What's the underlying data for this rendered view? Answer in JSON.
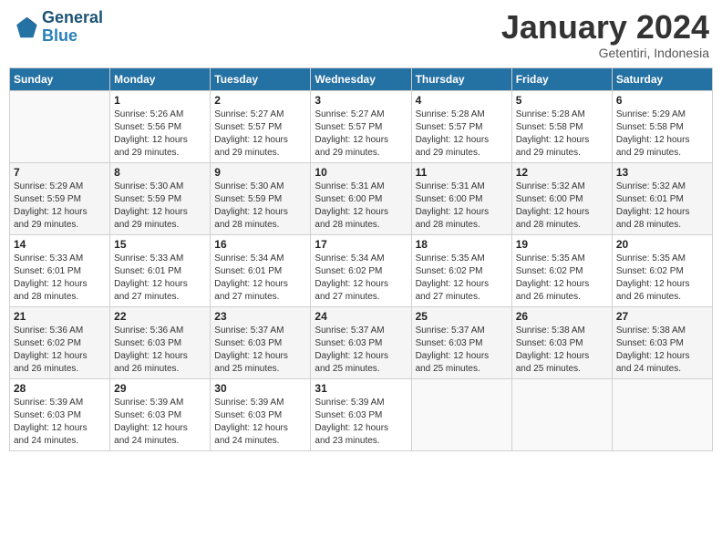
{
  "header": {
    "logo_line1": "General",
    "logo_line2": "Blue",
    "month": "January 2024",
    "location": "Getentiri, Indonesia"
  },
  "weekdays": [
    "Sunday",
    "Monday",
    "Tuesday",
    "Wednesday",
    "Thursday",
    "Friday",
    "Saturday"
  ],
  "weeks": [
    [
      {
        "day": "",
        "info": ""
      },
      {
        "day": "1",
        "info": "Sunrise: 5:26 AM\nSunset: 5:56 PM\nDaylight: 12 hours\nand 29 minutes."
      },
      {
        "day": "2",
        "info": "Sunrise: 5:27 AM\nSunset: 5:57 PM\nDaylight: 12 hours\nand 29 minutes."
      },
      {
        "day": "3",
        "info": "Sunrise: 5:27 AM\nSunset: 5:57 PM\nDaylight: 12 hours\nand 29 minutes."
      },
      {
        "day": "4",
        "info": "Sunrise: 5:28 AM\nSunset: 5:57 PM\nDaylight: 12 hours\nand 29 minutes."
      },
      {
        "day": "5",
        "info": "Sunrise: 5:28 AM\nSunset: 5:58 PM\nDaylight: 12 hours\nand 29 minutes."
      },
      {
        "day": "6",
        "info": "Sunrise: 5:29 AM\nSunset: 5:58 PM\nDaylight: 12 hours\nand 29 minutes."
      }
    ],
    [
      {
        "day": "7",
        "info": "Sunrise: 5:29 AM\nSunset: 5:59 PM\nDaylight: 12 hours\nand 29 minutes."
      },
      {
        "day": "8",
        "info": "Sunrise: 5:30 AM\nSunset: 5:59 PM\nDaylight: 12 hours\nand 29 minutes."
      },
      {
        "day": "9",
        "info": "Sunrise: 5:30 AM\nSunset: 5:59 PM\nDaylight: 12 hours\nand 28 minutes."
      },
      {
        "day": "10",
        "info": "Sunrise: 5:31 AM\nSunset: 6:00 PM\nDaylight: 12 hours\nand 28 minutes."
      },
      {
        "day": "11",
        "info": "Sunrise: 5:31 AM\nSunset: 6:00 PM\nDaylight: 12 hours\nand 28 minutes."
      },
      {
        "day": "12",
        "info": "Sunrise: 5:32 AM\nSunset: 6:00 PM\nDaylight: 12 hours\nand 28 minutes."
      },
      {
        "day": "13",
        "info": "Sunrise: 5:32 AM\nSunset: 6:01 PM\nDaylight: 12 hours\nand 28 minutes."
      }
    ],
    [
      {
        "day": "14",
        "info": "Sunrise: 5:33 AM\nSunset: 6:01 PM\nDaylight: 12 hours\nand 28 minutes."
      },
      {
        "day": "15",
        "info": "Sunrise: 5:33 AM\nSunset: 6:01 PM\nDaylight: 12 hours\nand 27 minutes."
      },
      {
        "day": "16",
        "info": "Sunrise: 5:34 AM\nSunset: 6:01 PM\nDaylight: 12 hours\nand 27 minutes."
      },
      {
        "day": "17",
        "info": "Sunrise: 5:34 AM\nSunset: 6:02 PM\nDaylight: 12 hours\nand 27 minutes."
      },
      {
        "day": "18",
        "info": "Sunrise: 5:35 AM\nSunset: 6:02 PM\nDaylight: 12 hours\nand 27 minutes."
      },
      {
        "day": "19",
        "info": "Sunrise: 5:35 AM\nSunset: 6:02 PM\nDaylight: 12 hours\nand 26 minutes."
      },
      {
        "day": "20",
        "info": "Sunrise: 5:35 AM\nSunset: 6:02 PM\nDaylight: 12 hours\nand 26 minutes."
      }
    ],
    [
      {
        "day": "21",
        "info": "Sunrise: 5:36 AM\nSunset: 6:02 PM\nDaylight: 12 hours\nand 26 minutes."
      },
      {
        "day": "22",
        "info": "Sunrise: 5:36 AM\nSunset: 6:03 PM\nDaylight: 12 hours\nand 26 minutes."
      },
      {
        "day": "23",
        "info": "Sunrise: 5:37 AM\nSunset: 6:03 PM\nDaylight: 12 hours\nand 25 minutes."
      },
      {
        "day": "24",
        "info": "Sunrise: 5:37 AM\nSunset: 6:03 PM\nDaylight: 12 hours\nand 25 minutes."
      },
      {
        "day": "25",
        "info": "Sunrise: 5:37 AM\nSunset: 6:03 PM\nDaylight: 12 hours\nand 25 minutes."
      },
      {
        "day": "26",
        "info": "Sunrise: 5:38 AM\nSunset: 6:03 PM\nDaylight: 12 hours\nand 25 minutes."
      },
      {
        "day": "27",
        "info": "Sunrise: 5:38 AM\nSunset: 6:03 PM\nDaylight: 12 hours\nand 24 minutes."
      }
    ],
    [
      {
        "day": "28",
        "info": "Sunrise: 5:39 AM\nSunset: 6:03 PM\nDaylight: 12 hours\nand 24 minutes."
      },
      {
        "day": "29",
        "info": "Sunrise: 5:39 AM\nSunset: 6:03 PM\nDaylight: 12 hours\nand 24 minutes."
      },
      {
        "day": "30",
        "info": "Sunrise: 5:39 AM\nSunset: 6:03 PM\nDaylight: 12 hours\nand 24 minutes."
      },
      {
        "day": "31",
        "info": "Sunrise: 5:39 AM\nSunset: 6:03 PM\nDaylight: 12 hours\nand 23 minutes."
      },
      {
        "day": "",
        "info": ""
      },
      {
        "day": "",
        "info": ""
      },
      {
        "day": "",
        "info": ""
      }
    ]
  ]
}
